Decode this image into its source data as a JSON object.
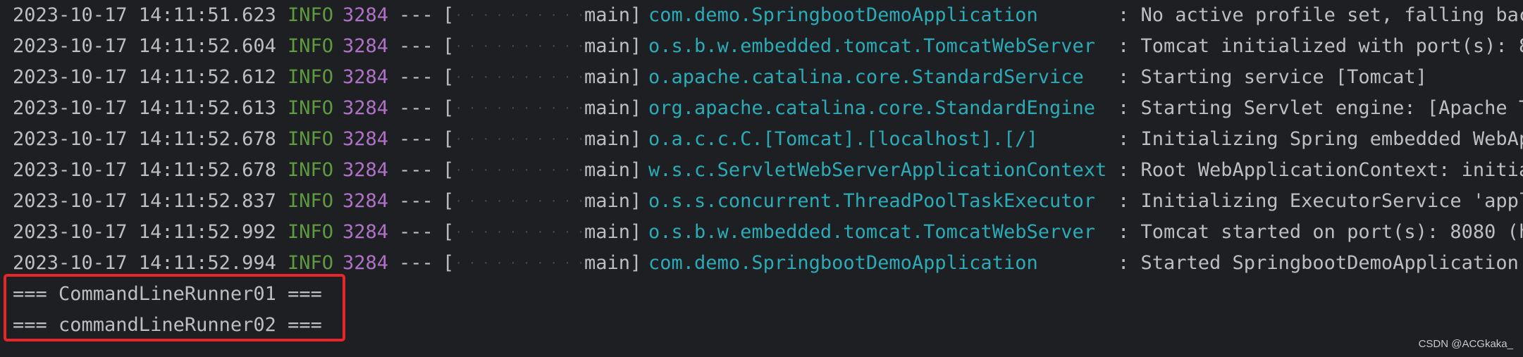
{
  "console": {
    "log_lines": [
      {
        "timestamp": "2023-10-17 14:11:51.623",
        "level": "INFO",
        "pid": "3284",
        "sep": "---",
        "thread": "main",
        "logger": "com.demo.SpringbootDemoApplication",
        "message": ": No active profile set, falling bac"
      },
      {
        "timestamp": "2023-10-17 14:11:52.604",
        "level": "INFO",
        "pid": "3284",
        "sep": "---",
        "thread": "main",
        "logger": "o.s.b.w.embedded.tomcat.TomcatWebServer",
        "message": ": Tomcat initialized with port(s): 8"
      },
      {
        "timestamp": "2023-10-17 14:11:52.612",
        "level": "INFO",
        "pid": "3284",
        "sep": "---",
        "thread": "main",
        "logger": "o.apache.catalina.core.StandardService",
        "message": ": Starting service [Tomcat]"
      },
      {
        "timestamp": "2023-10-17 14:11:52.613",
        "level": "INFO",
        "pid": "3284",
        "sep": "---",
        "thread": "main",
        "logger": "org.apache.catalina.core.StandardEngine",
        "message": ": Starting Servlet engine: [Apache T"
      },
      {
        "timestamp": "2023-10-17 14:11:52.678",
        "level": "INFO",
        "pid": "3284",
        "sep": "---",
        "thread": "main",
        "logger": "o.a.c.c.C.[Tomcat].[localhost].[/]",
        "message": ": Initializing Spring embedded WebAp"
      },
      {
        "timestamp": "2023-10-17 14:11:52.678",
        "level": "INFO",
        "pid": "3284",
        "sep": "---",
        "thread": "main",
        "logger": "w.s.c.ServletWebServerApplicationContext",
        "message": ": Root WebApplicationContext: initia"
      },
      {
        "timestamp": "2023-10-17 14:11:52.837",
        "level": "INFO",
        "pid": "3284",
        "sep": "---",
        "thread": "main",
        "logger": "o.s.s.concurrent.ThreadPoolTaskExecutor",
        "message": ": Initializing ExecutorService 'appl"
      },
      {
        "timestamp": "2023-10-17 14:11:52.992",
        "level": "INFO",
        "pid": "3284",
        "sep": "---",
        "thread": "main",
        "logger": "o.s.b.w.embedded.tomcat.TomcatWebServer",
        "message": ": Tomcat started on port(s): 8080 (h"
      },
      {
        "timestamp": "2023-10-17 14:11:52.994",
        "level": "INFO",
        "pid": "3284",
        "sep": "---",
        "thread": "main",
        "logger": "com.demo.SpringbootDemoApplication",
        "message": ": Started SpringbootDemoApplication"
      }
    ],
    "output_lines": [
      "=== CommandLineRunner01 ===",
      "=== commandLineRunner02 ==="
    ]
  },
  "watermark": "CSDN @ACGkaka_",
  "colors": {
    "background": "#1e1f22",
    "text": "#bcbec4",
    "info": "#5f9b3e",
    "pid": "#b072c9",
    "logger": "#2aacb8",
    "dots": "#4a4c52",
    "highlight_border": "#e8262a"
  }
}
